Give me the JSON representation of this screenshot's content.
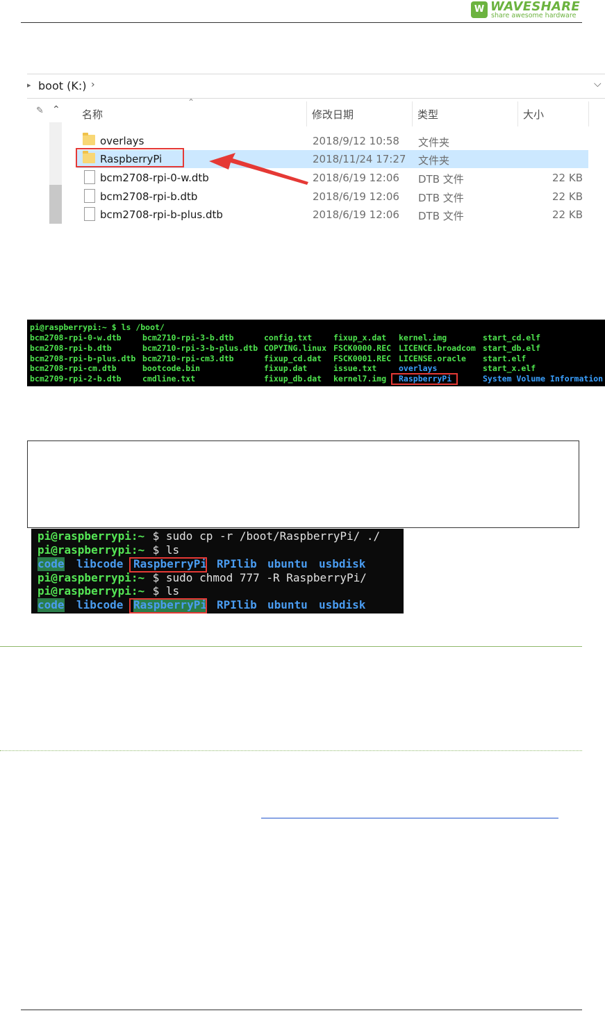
{
  "header": {
    "logo_badge": "W",
    "logo_name": "WAVESHARE",
    "logo_tagline": "share awesome hardware",
    "brand_color": "#6cb33f"
  },
  "explorer": {
    "address": "boot (K:)",
    "address_chevron": "›",
    "columns": {
      "name": "名称",
      "modified": "修改日期",
      "type": "类型",
      "size": "大小"
    },
    "rows": [
      {
        "name": "overlays",
        "modified": "2018/9/12 10:58",
        "type": "文件夹",
        "size": "",
        "icon": "folder-icon"
      },
      {
        "name": "RaspberryPi",
        "modified": "2018/11/24 17:27",
        "type": "文件夹",
        "size": "",
        "icon": "folder-icon",
        "selected": true
      },
      {
        "name": "bcm2708-rpi-0-w.dtb",
        "modified": "2018/6/19 12:06",
        "type": "DTB 文件",
        "size": "22 KB",
        "icon": "file-icon"
      },
      {
        "name": "bcm2708-rpi-b.dtb",
        "modified": "2018/6/19 12:06",
        "type": "DTB 文件",
        "size": "22 KB",
        "icon": "file-icon"
      },
      {
        "name": "bcm2708-rpi-b-plus.dtb",
        "modified": "2018/6/19 12:06",
        "type": "DTB 文件",
        "size": "22 KB",
        "icon": "file-icon"
      }
    ],
    "highlight_color": "#e53935"
  },
  "terminal1": {
    "prompt": "pi@raspberrypi:~ $ ls /boot/",
    "columns": [
      [
        "bcm2708-rpi-0-w.dtb",
        "bcm2708-rpi-b.dtb",
        "bcm2708-rpi-b-plus.dtb",
        "bcm2708-rpi-cm.dtb",
        "bcm2709-rpi-2-b.dtb"
      ],
      [
        "bcm2710-rpi-3-b.dtb",
        "bcm2710-rpi-3-b-plus.dtb",
        "bcm2710-rpi-cm3.dtb",
        "bootcode.bin",
        "cmdline.txt"
      ],
      [
        "config.txt",
        "COPYING.linux",
        "fixup_cd.dat",
        "fixup.dat",
        "fixup_db.dat"
      ],
      [
        "fixup_x.dat",
        "FSCK0000.REC",
        "FSCK0001.REC",
        "issue.txt",
        "kernel7.img"
      ],
      [
        "kernel.img",
        "LICENCE.broadcom",
        "LICENSE.oracle",
        "overlays",
        "RaspberryPi"
      ],
      [
        "start_cd.elf",
        "start_db.elf",
        "start.elf",
        "start_x.elf",
        "System Volume Information"
      ]
    ]
  },
  "terminal2": {
    "lines": [
      {
        "prompt": "pi@raspberrypi:~",
        "cmd": " $ sudo cp -r /boot/RaspberryPi/ ./"
      },
      {
        "prompt": "pi@raspberrypi:~",
        "cmd": " $ ls"
      },
      {
        "listing": [
          "code",
          "libcode",
          "RaspberryPi",
          "RPIlib",
          "ubuntu",
          "usbdisk"
        ]
      },
      {
        "prompt": "pi@raspberrypi:~",
        "cmd": " $ sudo chmod 777 -R RaspberryPi/"
      },
      {
        "prompt": "pi@raspberrypi:~",
        "cmd": " $ ls"
      },
      {
        "listing": [
          "code",
          "libcode",
          "RaspberryPi",
          "RPIlib",
          "ubuntu",
          "usbdisk"
        ]
      }
    ]
  }
}
